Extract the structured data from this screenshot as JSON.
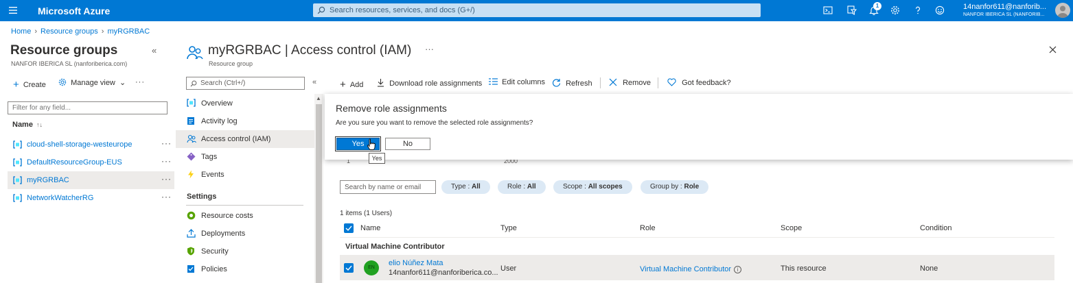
{
  "topbar": {
    "brand": "Microsoft Azure",
    "search_placeholder": "Search resources, services, and docs (G+/)",
    "notifications_count": "1",
    "user_email": "14nanfor611@nanforib...",
    "user_tenant": "NANFOR IBERICA SL (NANFORIB...",
    "icons": [
      "cloud-shell-icon",
      "directory-filter-icon",
      "notifications-icon",
      "settings-icon",
      "help-icon",
      "feedback-icon"
    ]
  },
  "breadcrumb": {
    "items": [
      "Home",
      "Resource groups",
      "myRGRBAC"
    ]
  },
  "left_panel": {
    "title": "Resource groups",
    "subtitle": "NANFOR IBERICA SL (nanforiberica.com)",
    "collapse": "«",
    "create": "Create",
    "manage_view": "Manage view",
    "more": "···",
    "filter_placeholder": "Filter for any field...",
    "name_column": "Name",
    "sort": "↑↓",
    "groups": [
      {
        "name": "cloud-shell-storage-westeurope",
        "more": "···"
      },
      {
        "name": "DefaultResourceGroup-EUS",
        "more": "···"
      },
      {
        "name": "myRGRBAC",
        "more": "···"
      },
      {
        "name": "NetworkWatcherRG",
        "more": "···"
      }
    ]
  },
  "iam": {
    "title": "myRGRBAC | Access control (IAM)",
    "subtitle": "Resource group",
    "more": "···",
    "close": "✕"
  },
  "resource_menu": {
    "search_placeholder": "Search (Ctrl+/)",
    "collapse": "«",
    "items": [
      "Overview",
      "Activity log",
      "Access control (IAM)",
      "Tags",
      "Events"
    ],
    "settings_header": "Settings",
    "settings_items": [
      "Resource costs",
      "Deployments",
      "Security",
      "Policies"
    ]
  },
  "toolbar": {
    "add": "Add",
    "download": "Download role assignments",
    "edit_columns": "Edit columns",
    "refresh": "Refresh",
    "remove": "Remove",
    "feedback": "Got feedback?"
  },
  "content": {
    "partial_1": "1",
    "partial_2": "2000",
    "search_placeholder": "Search by name or email",
    "filters": [
      {
        "label": "Type : ",
        "value": "All"
      },
      {
        "label": "Role : ",
        "value": "All"
      },
      {
        "label": "Scope : ",
        "value": "All scopes"
      },
      {
        "label": "Group by : ",
        "value": "Role"
      }
    ],
    "items_count": "1 items (1 Users)",
    "columns": [
      "Name",
      "Type",
      "Role",
      "Scope",
      "Condition"
    ],
    "group_label": "Virtual Machine Contributor",
    "row": {
      "initials": "EN",
      "name": "elio Núñez Mata",
      "email": "14nanfor611@nanforiberica.co...",
      "type": "User",
      "role": "Virtual Machine Contributor",
      "info": "i",
      "scope": "This resource",
      "condition": "None"
    }
  },
  "dialog": {
    "title": "Remove role assignments",
    "message": "Are you sure you want to remove the selected role assignments?",
    "yes": "Yes",
    "no": "No",
    "tooltip": "Yes"
  },
  "colors": {
    "accent": "#0078d4",
    "selected_bg": "#edebe9",
    "pill_bg": "#dce9f5",
    "avatar_green": "#21a121"
  }
}
